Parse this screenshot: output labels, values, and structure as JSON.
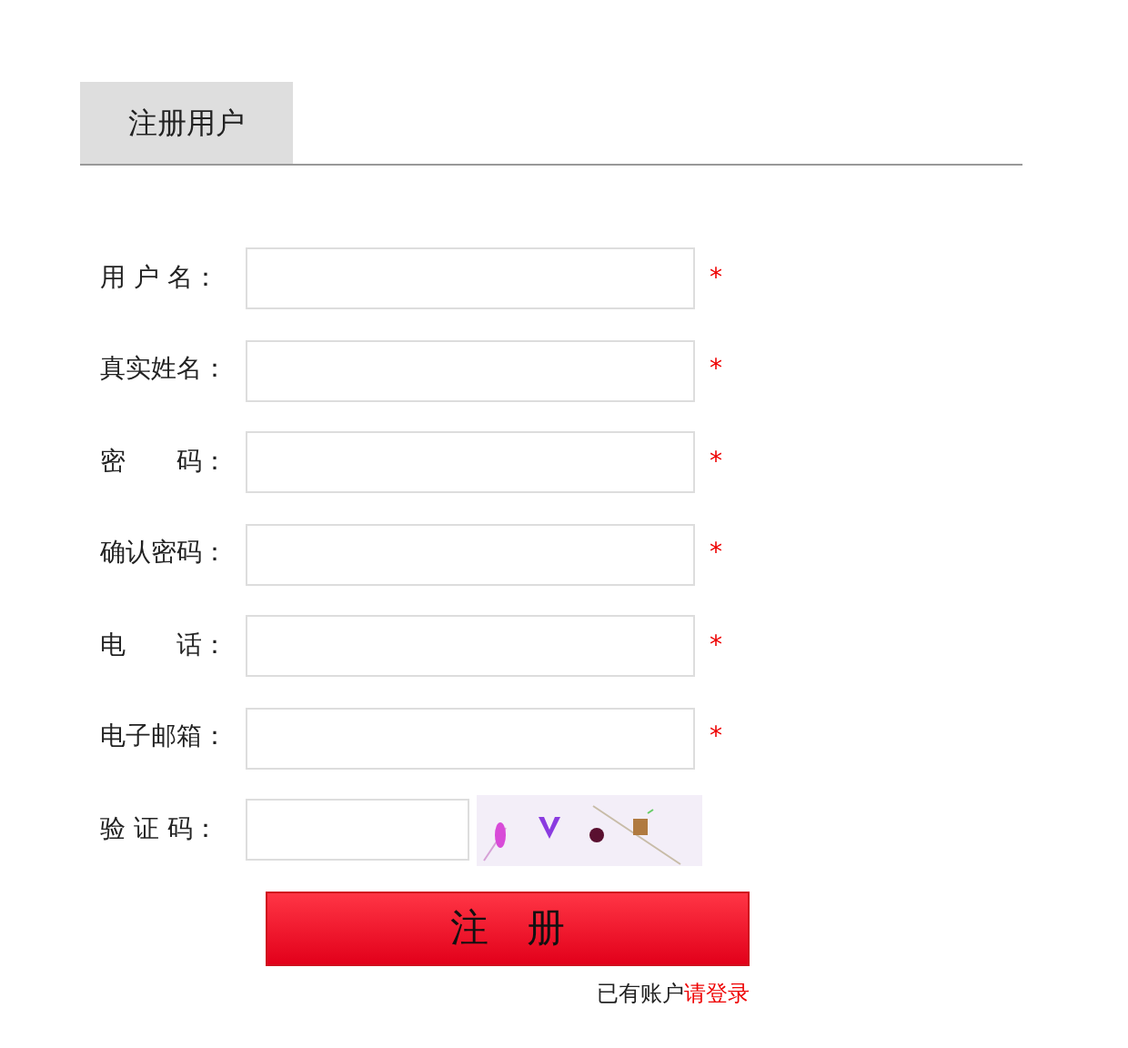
{
  "tab": {
    "label": "注册用户",
    "selected": true
  },
  "fields": [
    {
      "label": "用 户 名：",
      "required": true,
      "mark": "*"
    },
    {
      "label": "真实姓名：",
      "required": true,
      "mark": "*"
    },
    {
      "label": "密　　码：",
      "required": true,
      "mark": "*"
    },
    {
      "label": "确认密码：",
      "required": true,
      "mark": "*"
    },
    {
      "label": "电　　话：",
      "required": true,
      "mark": "*"
    },
    {
      "label": "电子邮箱：",
      "required": true,
      "mark": "*"
    }
  ],
  "captcha": {
    "label": "验 证 码："
  },
  "submit": "注　册",
  "login_prompt": {
    "text": "已有账户",
    "link": "请登录"
  }
}
